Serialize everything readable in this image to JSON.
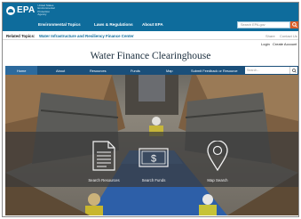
{
  "header": {
    "logo_text": "EPA",
    "logo_subtext": "United States Environmental Protection Agency",
    "nav": [
      "Environmental Topics",
      "Laws & Regulations",
      "About EPA"
    ],
    "search_placeholder": "Search EPA.gov"
  },
  "related": {
    "label": "Related Topics:",
    "link": "Water Infrastructure and Resiliency Finance Center",
    "share": "Share",
    "contact": "Contact Us"
  },
  "account": {
    "login": "Login",
    "create": "Create Account"
  },
  "site_title": "Water Finance Clearinghouse",
  "sub_nav": [
    "Home",
    "About",
    "Resources",
    "Funds",
    "Map",
    "Submit Feedback or Resource"
  ],
  "sub_search_placeholder": "Search...",
  "tiles": [
    {
      "label": "Search Resources",
      "icon": "document-icon"
    },
    {
      "label": "Search Funds",
      "icon": "money-icon"
    },
    {
      "label": "Map Search",
      "icon": "map-pin-icon"
    }
  ],
  "colors": {
    "header_blue": "#0e6c9c",
    "subnav_blue": "#1a4f7a",
    "search_orange": "#d95d27"
  }
}
